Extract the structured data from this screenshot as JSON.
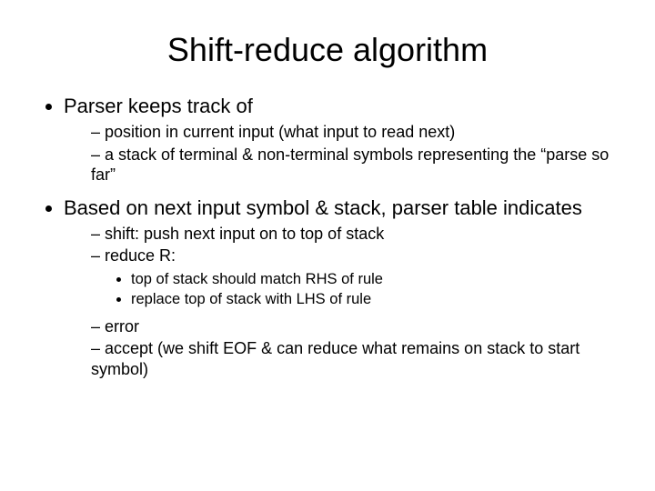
{
  "title": "Shift-reduce algorithm",
  "b1": {
    "text": "Parser keeps track of",
    "sub": [
      "position in current input (what input to read next)",
      "a stack of terminal & non-terminal symbols representing the “parse so far”"
    ]
  },
  "b2": {
    "text": "Based on next input symbol & stack, parser table indicates",
    "sub1": "shift: push next input on to top of stack",
    "sub2": {
      "text": "reduce R:",
      "subsub": [
        "top of stack should match RHS of rule",
        "replace top of stack with LHS of rule"
      ]
    },
    "sub3": "error",
    "sub4": "accept (we shift EOF & can reduce what remains on stack to start symbol)"
  }
}
